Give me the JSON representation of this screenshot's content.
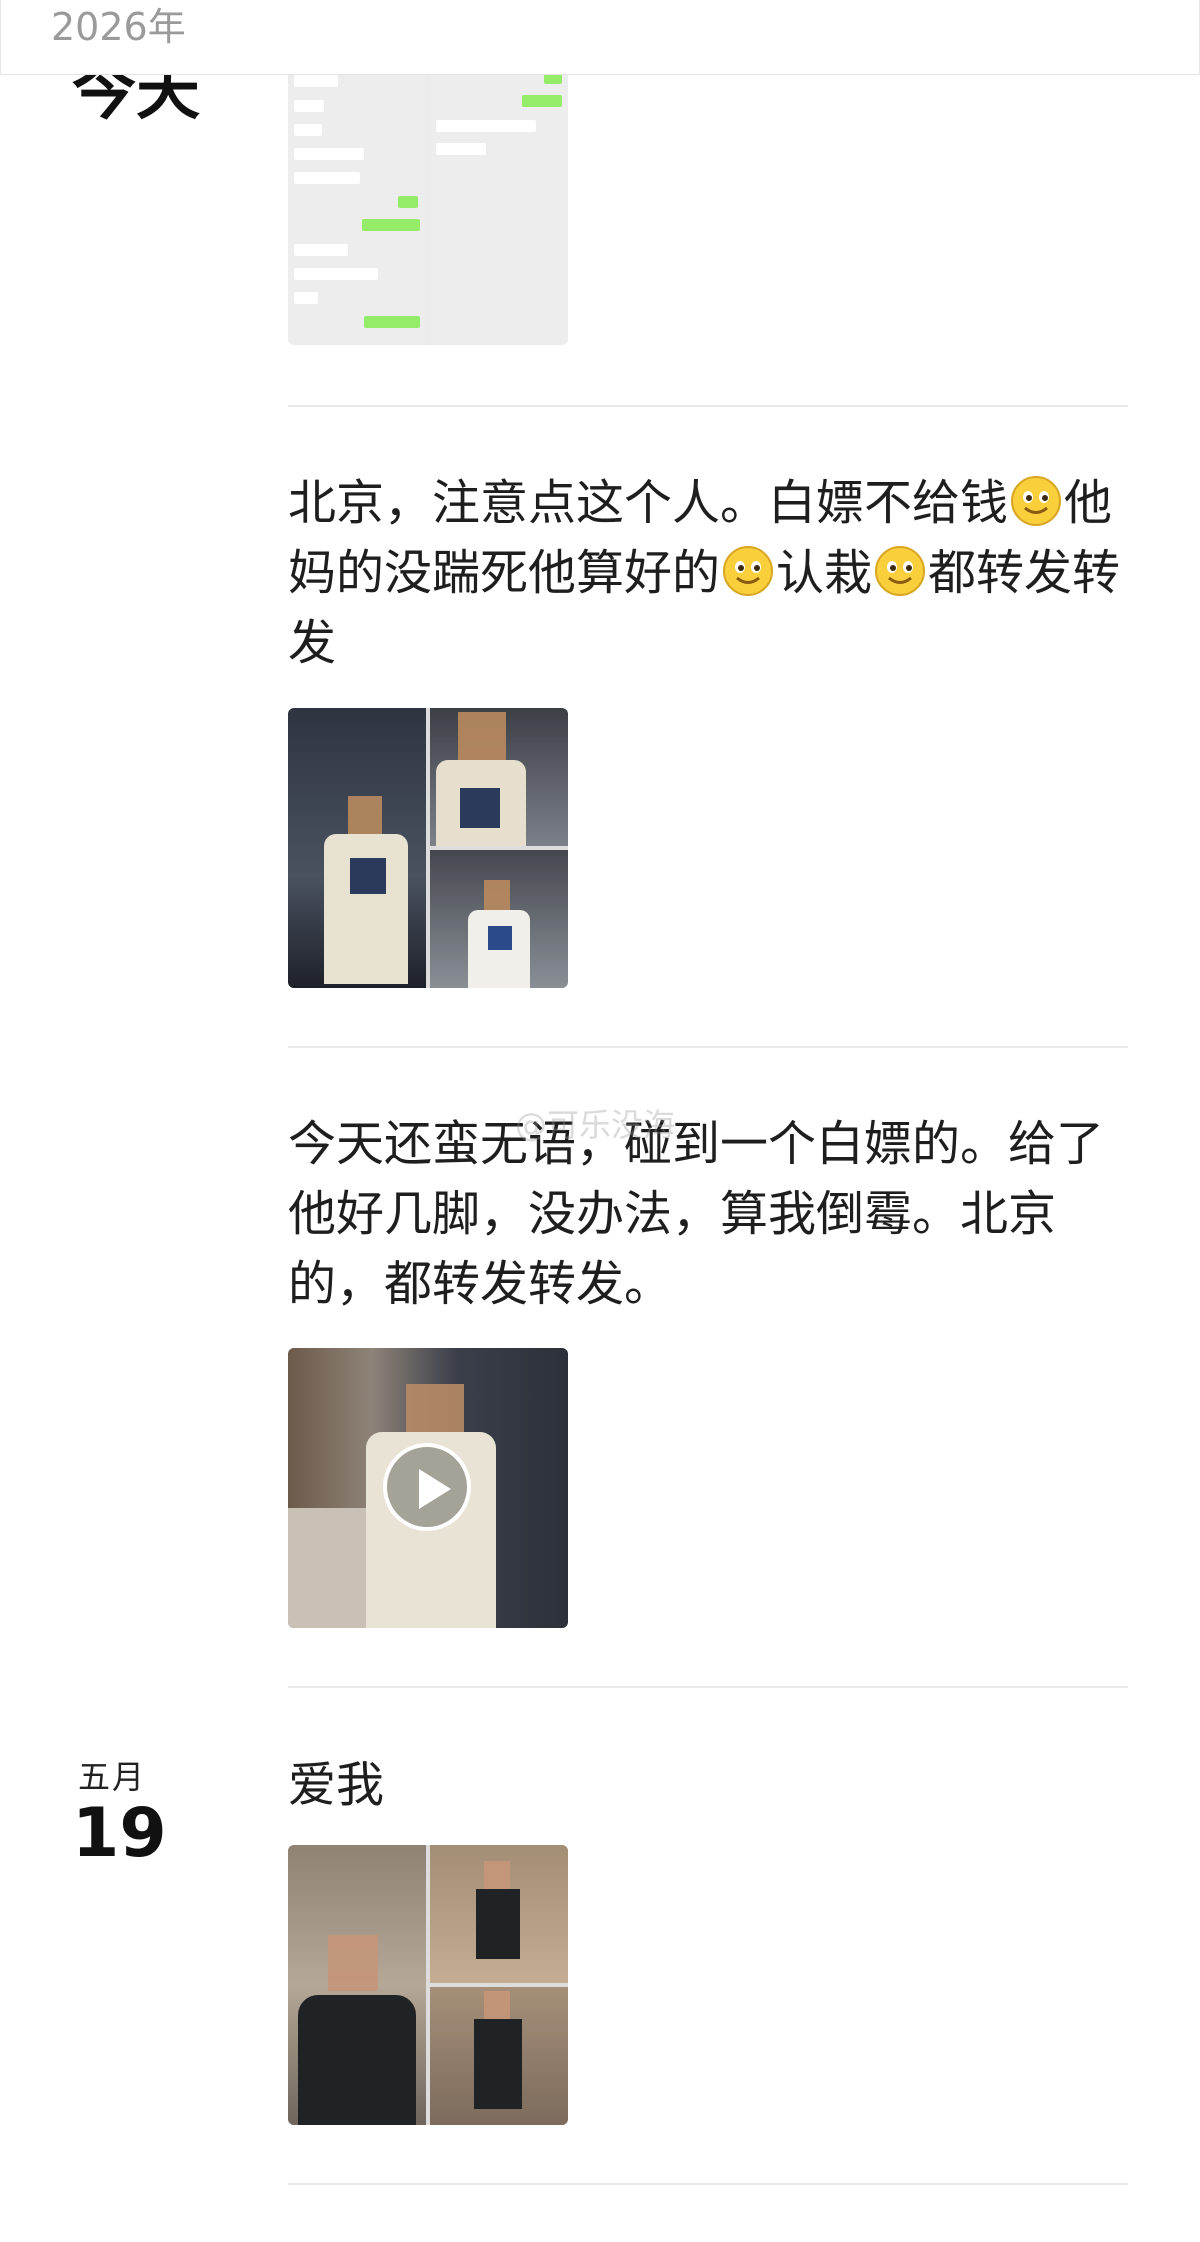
{
  "header": {
    "year": "2026年"
  },
  "dates": {
    "today": "今天",
    "may_month": "五月",
    "may_day": "19"
  },
  "posts": [
    {
      "text_parts": [
        "北京，注意点这个人。白嫖不给钱",
        "他妈的没踹死他算好的",
        "认栽",
        "都转发转发"
      ],
      "media_type": "image-grid-3"
    },
    {
      "text": "今天还蛮无语，碰到一个白嫖的。给了他好几脚，没办法，算我倒霉。北京的，都转发转发。",
      "media_type": "video"
    },
    {
      "text": "爱我",
      "media_type": "image-grid-3"
    }
  ],
  "watermark": "@可乐没海",
  "icons": {
    "emoji": "smiley-emoji-icon",
    "play": "play-icon"
  },
  "colors": {
    "chat_green": "#95ec69",
    "divider": "#e8e8e8"
  }
}
